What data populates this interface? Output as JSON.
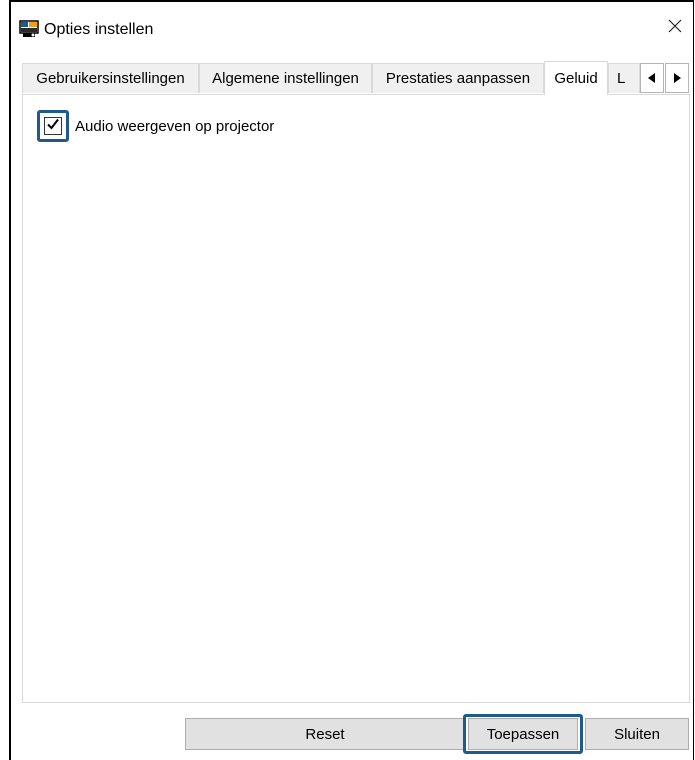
{
  "window": {
    "title": "Opties instellen",
    "icon": "projector-app-icon",
    "close_icon": "close-icon"
  },
  "tabs": [
    {
      "label": "Gebruikersinstellingen",
      "active": false
    },
    {
      "label": "Algemene instellingen",
      "active": false
    },
    {
      "label": "Prestaties aanpassen",
      "active": false
    },
    {
      "label": "Geluid",
      "active": true
    },
    {
      "label": "L",
      "active": false
    }
  ],
  "tab_scroll": {
    "left_icon": "arrow-left-icon",
    "right_icon": "arrow-right-icon"
  },
  "sound_panel": {
    "audio_checkbox_label": "Audio weergeven op projector",
    "audio_checked": true
  },
  "buttons": {
    "reset": "Reset",
    "apply": "Toepassen",
    "close": "Sluiten"
  },
  "colors": {
    "highlight": "#1e5a8c",
    "button_bg": "#e1e1e1",
    "tab_bg": "#f0f0f0"
  }
}
